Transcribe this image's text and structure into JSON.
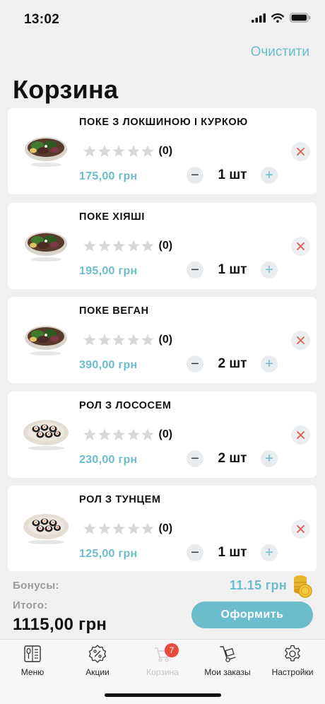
{
  "status_bar": {
    "time": "13:02"
  },
  "header": {
    "clear_label": "Очистити",
    "title": "Корзина"
  },
  "colors": {
    "accent": "#6bbdcc",
    "remove": "#e05a4f",
    "badge": "#e64b3c",
    "star": "#d8d8d8"
  },
  "items": [
    {
      "name": "ПОКЕ З ЛОКШИНОЮ І КУРКОЮ",
      "reviews": "(0)",
      "price": "175,00 грн",
      "qty": "1 шт",
      "rating": 0,
      "dish": "poke"
    },
    {
      "name": "ПОКЕ ХІЯШІ",
      "reviews": "(0)",
      "price": "195,00 грн",
      "qty": "1 шт",
      "rating": 0,
      "dish": "poke"
    },
    {
      "name": "ПОКЕ ВЕГАН",
      "reviews": "(0)",
      "price": "390,00 грн",
      "qty": "2 шт",
      "rating": 0,
      "dish": "poke"
    },
    {
      "name": "РОЛ З ЛОСОСЕМ",
      "reviews": "(0)",
      "price": "230,00 грн",
      "qty": "2 шт",
      "rating": 0,
      "dish": "roll"
    },
    {
      "name": "РОЛ З ТУНЦЕМ",
      "reviews": "(0)",
      "price": "125,00 грн",
      "qty": "1 шт",
      "rating": 0,
      "dish": "roll"
    }
  ],
  "summary": {
    "bonus_label": "Бонусы:",
    "bonus_value": "11.15 грн",
    "total_label": "Итого:",
    "total_value": "1115,00 грн",
    "checkout_label": "Оформить"
  },
  "tabs": [
    {
      "label": "Меню",
      "icon": "menu-book-icon",
      "active": true
    },
    {
      "label": "Акции",
      "icon": "discount-badge-icon",
      "active": true
    },
    {
      "label": "Корзина",
      "icon": "cart-icon",
      "active": false,
      "badge": "7"
    },
    {
      "label": "Мои заказы",
      "icon": "hand-truck-icon",
      "active": true
    },
    {
      "label": "Настройки",
      "icon": "gear-icon",
      "active": true
    }
  ]
}
